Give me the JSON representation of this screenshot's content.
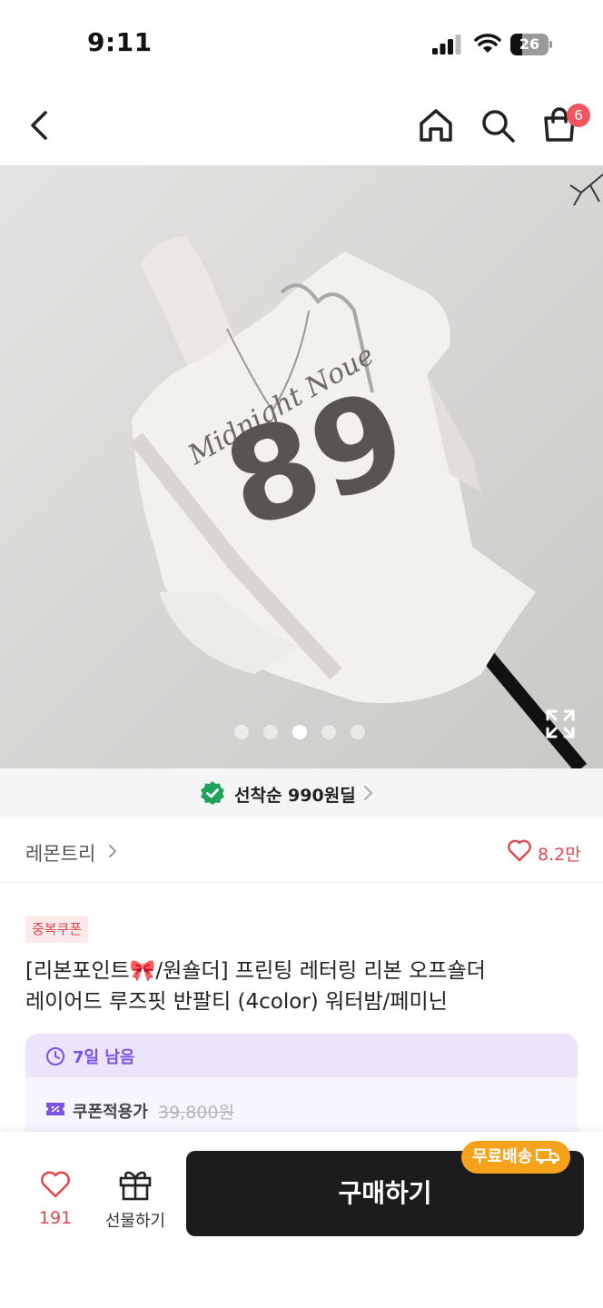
{
  "status_bar": {
    "time": "9:11",
    "battery_level": "26"
  },
  "nav": {
    "icons": [
      "back-icon",
      "home-icon",
      "search-icon",
      "cart-icon"
    ],
    "cart_badge": "6"
  },
  "gallery": {
    "total_images": 5,
    "current_index": 3,
    "print_text": "Midnight Noue",
    "print_number": "89"
  },
  "promo": {
    "text": "선착순 990원딜"
  },
  "store": {
    "name": "레몬트리",
    "like_count": "8.2만"
  },
  "product": {
    "coupon_tag": "중복쿠폰",
    "title_line1": "[리본포인트🎀/원숄더] 프린팅 레터링 리본 오프숄더",
    "title_line2": "레이어드 루즈핏 반팔티 (4color) 워터밤/페미닌"
  },
  "coupon_box": {
    "remaining": "7일 남음",
    "coupon_label": "쿠폰적용가",
    "original_price": "39,800원"
  },
  "bottom_bar": {
    "wish_count": "191",
    "gift_label": "선물하기",
    "buy_label": "구매하기",
    "free_shipping": "무료배송"
  },
  "colors": {
    "accent_red": "#e0484f",
    "accent_purple": "#7a52e8",
    "buy_button": "#1c1c1c",
    "free_shipping_badge": "#f7a21b",
    "check_green": "#1fa35a"
  }
}
